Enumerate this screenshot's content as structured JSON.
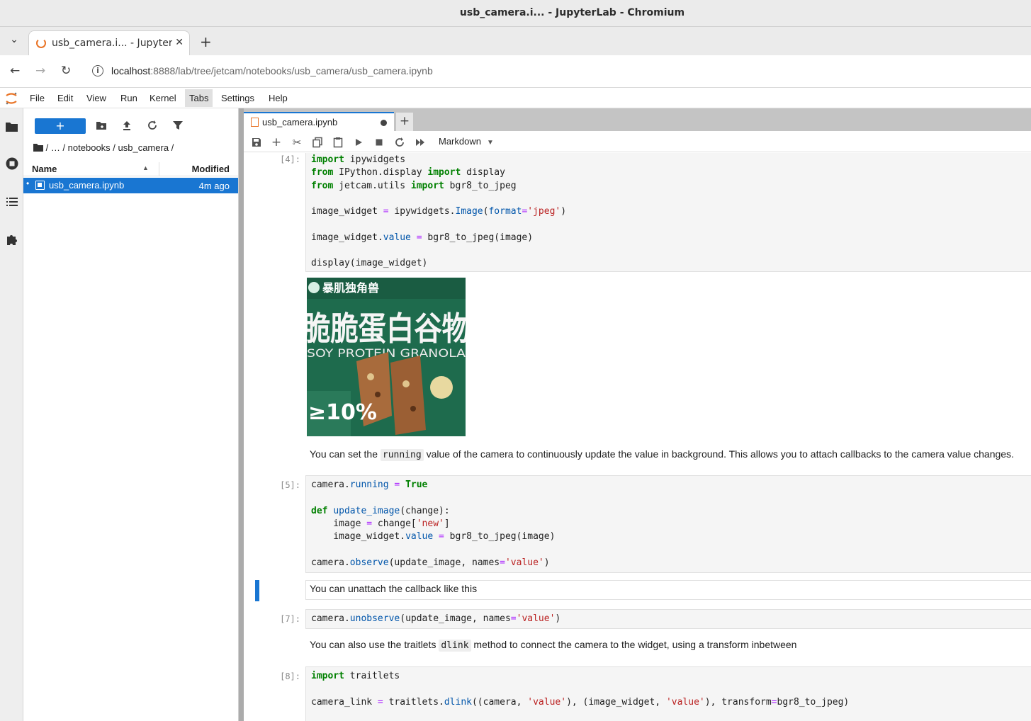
{
  "window": {
    "title": "usb_camera.i... - JupyterLab - Chromium"
  },
  "browser": {
    "tab_title": "usb_camera.i... - Jupyter",
    "url_host": "localhost",
    "url_rest": ":8888/lab/tree/jetcam/notebooks/usb_camera/usb_camera.ipynb"
  },
  "menubar": {
    "items": [
      "File",
      "Edit",
      "View",
      "Run",
      "Kernel",
      "Tabs",
      "Settings",
      "Help"
    ]
  },
  "filebrowser": {
    "new_label": "+",
    "breadcrumb": "/   …   / notebooks / usb_camera /",
    "col_name": "Name",
    "col_modified": "Modified",
    "files": [
      {
        "name": "usb_camera.ipynb",
        "modified": "4m ago"
      }
    ]
  },
  "notebook": {
    "tab_title": "usb_camera.ipynb",
    "cell_type": "Markdown",
    "prompts": {
      "c4": "[4]:",
      "c5": "[5]:",
      "c7": "[7]:",
      "c8": "[8]:"
    },
    "md1": {
      "pre": "You can set the ",
      "code": "running",
      "post": " value of the camera to continuously update the value in background. This allows you to attach callbacks to the camera value changes."
    },
    "md2": "You can unattach the callback like this",
    "md3": {
      "pre": "You can also use the traitlets ",
      "code": "dlink",
      "post": " method to connect the camera to the widget, using a transform inbetween"
    },
    "output_image": {
      "text_top": "暴肌独角兽",
      "text_big": "脆脆蛋白谷物",
      "text_soy": "SOY PROTEIN GRANOLA",
      "text_pct": "≥10%"
    }
  },
  "colors": {
    "accent": "#1976d2",
    "keyword": "#008000",
    "string": "#ba2121",
    "function": "#0055aa",
    "operator": "#aa22ff"
  }
}
